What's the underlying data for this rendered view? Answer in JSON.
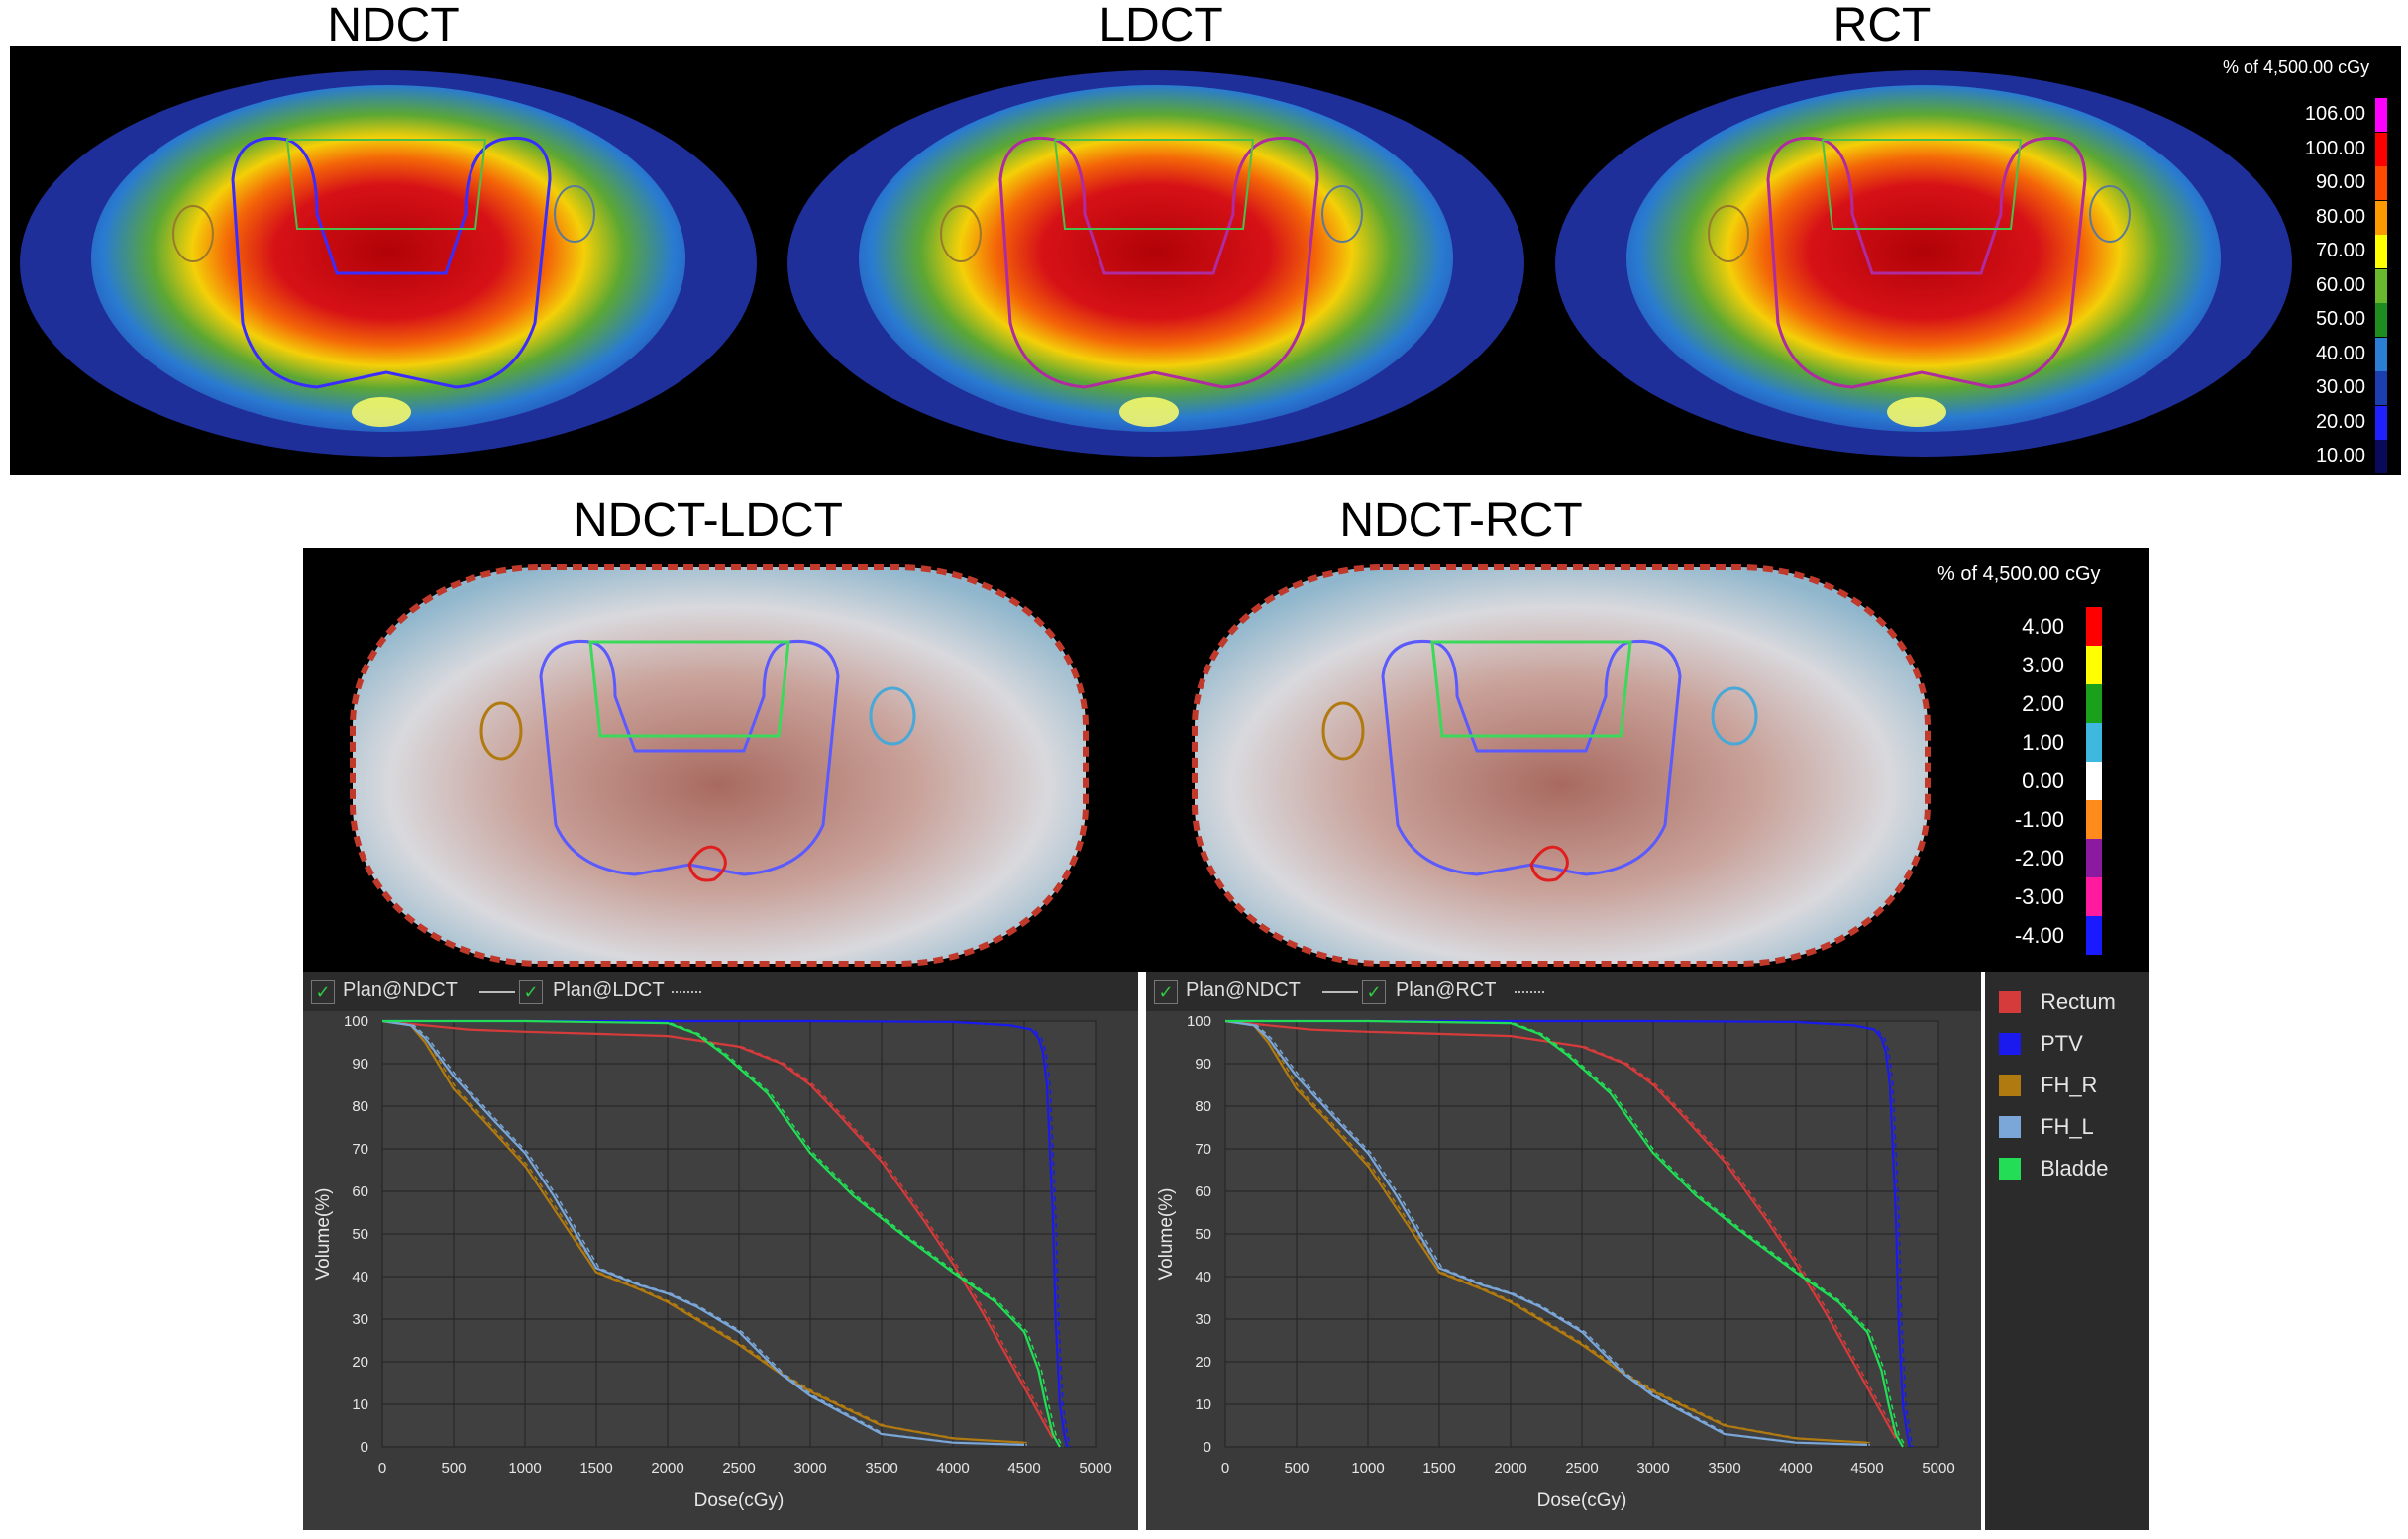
{
  "titles": {
    "ndct": "NDCT",
    "ldct": "LDCT",
    "rct": "RCT",
    "ndct_ldct": "NDCT-LDCT",
    "ndct_rct": "NDCT-RCT"
  },
  "dose_colorbar": {
    "header": "% of 4,500.00 cGy",
    "levels": [
      {
        "label": "106.00",
        "color": "#ff00ff"
      },
      {
        "label": "100.00",
        "color": "#ff0000"
      },
      {
        "label": "90.00",
        "color": "#ff4a00"
      },
      {
        "label": "80.00",
        "color": "#ff9900"
      },
      {
        "label": "70.00",
        "color": "#ffff00"
      },
      {
        "label": "60.00",
        "color": "#6ab82e"
      },
      {
        "label": "50.00",
        "color": "#1e8c1e"
      },
      {
        "label": "40.00",
        "color": "#2a7fd4"
      },
      {
        "label": "30.00",
        "color": "#1c3fb0"
      },
      {
        "label": "20.00",
        "color": "#2020ff"
      },
      {
        "label": "10.00",
        "color": "#0a0a5a"
      }
    ]
  },
  "diff_colorbar": {
    "header": "% of 4,500.00 cGy",
    "levels": [
      {
        "label": "4.00",
        "color": "#ff0000"
      },
      {
        "label": "3.00",
        "color": "#ffff00"
      },
      {
        "label": "2.00",
        "color": "#1aa01a"
      },
      {
        "label": "1.00",
        "color": "#3fb8e0"
      },
      {
        "label": "0.00",
        "color": "#ffffff"
      },
      {
        "label": "-1.00",
        "color": "#ff8c1a"
      },
      {
        "label": "-2.00",
        "color": "#8a1aa0"
      },
      {
        "label": "-3.00",
        "color": "#ff1aa0"
      },
      {
        "label": "-4.00",
        "color": "#1a1aff"
      }
    ]
  },
  "dvh_left": {
    "plan1": "Plan@NDCT",
    "plan2": "Plan@LDCT"
  },
  "dvh_right": {
    "plan1": "Plan@NDCT",
    "plan2": "Plan@RCT"
  },
  "dvh_legend": [
    {
      "label": "Rectum",
      "color": "#d63b3b"
    },
    {
      "label": "PTV",
      "color": "#1a1aee"
    },
    {
      "label": "FH_R",
      "color": "#b07a10"
    },
    {
      "label": "FH_L",
      "color": "#7aa6d8"
    },
    {
      "label": "Bladde",
      "color": "#22dd55"
    }
  ],
  "chart_data": [
    {
      "type": "line",
      "xlabel": "Dose(cGy)",
      "ylabel": "Volume(%)",
      "xlim": [
        0,
        5000
      ],
      "ylim": [
        0,
        100
      ],
      "xticks": [
        "0",
        "500",
        "1000",
        "1500",
        "2000",
        "2500",
        "3000",
        "3500",
        "4000",
        "4500",
        "5000"
      ],
      "yticks": [
        "0",
        "10",
        "20",
        "30",
        "40",
        "50",
        "60",
        "70",
        "80",
        "90",
        "100"
      ],
      "grid": true,
      "series": [
        {
          "name": "Rectum",
          "x": [
            0,
            300,
            600,
            1000,
            1500,
            2000,
            2500,
            2800,
            3000,
            3200,
            3500,
            3800,
            4000,
            4200,
            4400,
            4600,
            4700
          ],
          "y": [
            100,
            99,
            98,
            97.5,
            97,
            96.5,
            94,
            90,
            85,
            78,
            67,
            53,
            43,
            32,
            20,
            8,
            2
          ]
        },
        {
          "name": "PTV",
          "x": [
            0,
            2000,
            3000,
            4000,
            4400,
            4550,
            4600,
            4630,
            4660,
            4700,
            4720,
            4750,
            4780,
            4800
          ],
          "y": [
            100,
            100,
            100,
            99.8,
            99,
            98,
            96,
            93,
            85,
            55,
            30,
            10,
            3,
            0
          ]
        },
        {
          "name": "FH_R",
          "x": [
            0,
            200,
            300,
            500,
            700,
            1000,
            1200,
            1500,
            1800,
            2000,
            2200,
            2500,
            2800,
            3000,
            3500,
            4000,
            4500
          ],
          "y": [
            100,
            99,
            95,
            84,
            77,
            66,
            56,
            41,
            37,
            34,
            30,
            24,
            17,
            13,
            5,
            2,
            1
          ]
        },
        {
          "name": "FH_L",
          "x": [
            0,
            200,
            300,
            500,
            800,
            1000,
            1200,
            1500,
            1800,
            2000,
            2200,
            2500,
            2800,
            3000,
            3500,
            4000,
            4500
          ],
          "y": [
            100,
            99,
            96,
            87,
            76,
            69,
            59,
            42,
            38,
            36,
            33,
            27,
            17,
            12,
            3,
            1,
            0.5
          ]
        },
        {
          "name": "Bladde",
          "x": [
            0,
            1000,
            2000,
            2200,
            2400,
            2700,
            3000,
            3300,
            3600,
            4000,
            4300,
            4500,
            4600,
            4650,
            4700,
            4750
          ],
          "y": [
            100,
            100,
            99.5,
            97,
            92,
            83,
            69,
            59,
            51,
            41,
            34,
            27,
            18,
            10,
            3,
            0
          ]
        }
      ]
    },
    {
      "type": "line",
      "xlabel": "Dose(cGy)",
      "ylabel": "Volume(%)",
      "xlim": [
        0,
        5000
      ],
      "ylim": [
        0,
        100
      ],
      "xticks": [
        "0",
        "500",
        "1000",
        "1500",
        "2000",
        "2500",
        "3000",
        "3500",
        "4000",
        "4500",
        "5000"
      ],
      "yticks": [
        "0",
        "10",
        "20",
        "30",
        "40",
        "50",
        "60",
        "70",
        "80",
        "90",
        "100"
      ],
      "grid": true,
      "series": [
        {
          "name": "Rectum",
          "x": [
            0,
            300,
            600,
            1000,
            1500,
            2000,
            2500,
            2800,
            3000,
            3200,
            3500,
            3800,
            4000,
            4200,
            4400,
            4600,
            4700
          ],
          "y": [
            100,
            99,
            98,
            97.5,
            97,
            96.5,
            94,
            90,
            85,
            78,
            67,
            53,
            43,
            32,
            20,
            8,
            2
          ]
        },
        {
          "name": "PTV",
          "x": [
            0,
            2000,
            3000,
            4000,
            4400,
            4550,
            4600,
            4630,
            4660,
            4700,
            4720,
            4750,
            4780,
            4800
          ],
          "y": [
            100,
            100,
            100,
            99.8,
            99,
            98,
            96,
            93,
            85,
            55,
            30,
            10,
            3,
            0
          ]
        },
        {
          "name": "FH_R",
          "x": [
            0,
            200,
            300,
            500,
            700,
            1000,
            1200,
            1500,
            1800,
            2000,
            2200,
            2500,
            2800,
            3000,
            3500,
            4000,
            4500
          ],
          "y": [
            100,
            99,
            95,
            84,
            77,
            66,
            56,
            41,
            37,
            34,
            30,
            24,
            17,
            13,
            5,
            2,
            1
          ]
        },
        {
          "name": "FH_L",
          "x": [
            0,
            200,
            300,
            500,
            800,
            1000,
            1200,
            1500,
            1800,
            2000,
            2200,
            2500,
            2800,
            3000,
            3500,
            4000,
            4500
          ],
          "y": [
            100,
            99,
            96,
            87,
            76,
            69,
            59,
            42,
            38,
            36,
            33,
            27,
            17,
            12,
            3,
            1,
            0.5
          ]
        },
        {
          "name": "Bladde",
          "x": [
            0,
            1000,
            2000,
            2200,
            2400,
            2700,
            3000,
            3300,
            3600,
            4000,
            4300,
            4500,
            4600,
            4650,
            4700,
            4750
          ],
          "y": [
            100,
            100,
            99.5,
            97,
            92,
            83,
            69,
            59,
            51,
            41,
            34,
            27,
            18,
            10,
            3,
            0
          ]
        }
      ]
    }
  ]
}
